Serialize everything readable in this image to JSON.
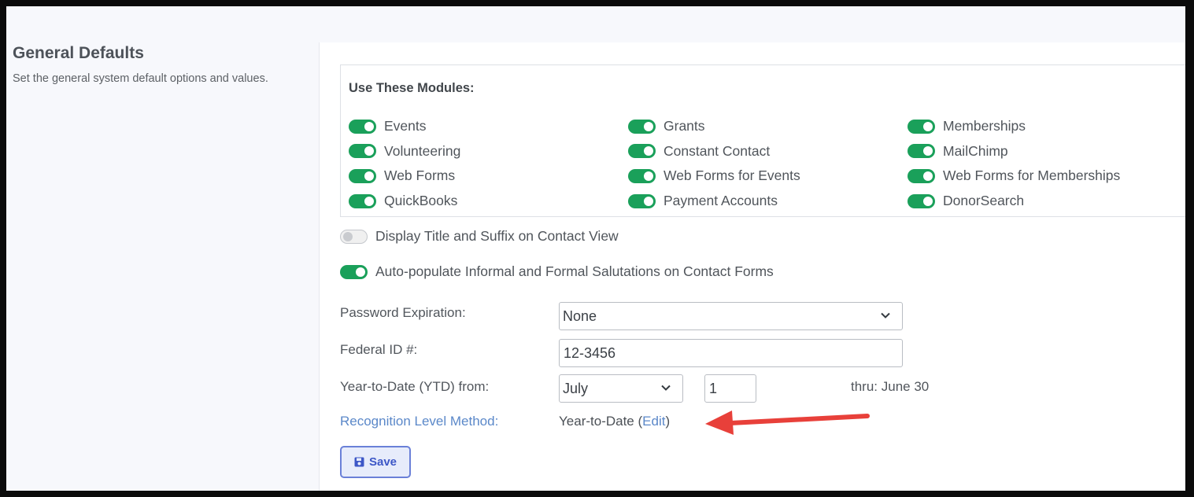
{
  "page": {
    "title": "General Defaults",
    "description": "Set the general system default options and values."
  },
  "modules": {
    "heading": "Use These Modules:",
    "items": [
      {
        "label": "Events",
        "enabled": true
      },
      {
        "label": "Grants",
        "enabled": true
      },
      {
        "label": "Memberships",
        "enabled": true
      },
      {
        "label": "Volunteering",
        "enabled": true
      },
      {
        "label": "Constant Contact",
        "enabled": true
      },
      {
        "label": "MailChimp",
        "enabled": true
      },
      {
        "label": "Web Forms",
        "enabled": true
      },
      {
        "label": "Web Forms for Events",
        "enabled": true
      },
      {
        "label": "Web Forms for Memberships",
        "enabled": true
      },
      {
        "label": "QuickBooks",
        "enabled": true
      },
      {
        "label": "Payment Accounts",
        "enabled": true
      },
      {
        "label": "DonorSearch",
        "enabled": true
      }
    ]
  },
  "options": {
    "display_title_suffix": {
      "label": "Display Title and Suffix on Contact View",
      "enabled": false
    },
    "auto_salutations": {
      "label": "Auto-populate Informal and Formal Salutations on Contact Forms",
      "enabled": true
    }
  },
  "form": {
    "password_expiration": {
      "label": "Password Expiration:",
      "value": "None"
    },
    "federal_id": {
      "label": "Federal ID #:",
      "value": "12-3456"
    },
    "ytd": {
      "label": "Year-to-Date (YTD) from:",
      "month": "July",
      "day": "1",
      "thru": "thru: June 30"
    },
    "recognition": {
      "label": "Recognition Level Method:",
      "value": "Year-to-Date (",
      "edit": "Edit",
      "close": ")"
    }
  },
  "actions": {
    "save_label": "Save"
  },
  "colors": {
    "toggle_on": "#1aa05a",
    "link": "#5b88c9",
    "save_border": "#6a80d8",
    "annotation_arrow": "#e8403a"
  },
  "icons": {
    "save": "floppy-disk-icon",
    "dropdown": "chevron-down-icon"
  }
}
